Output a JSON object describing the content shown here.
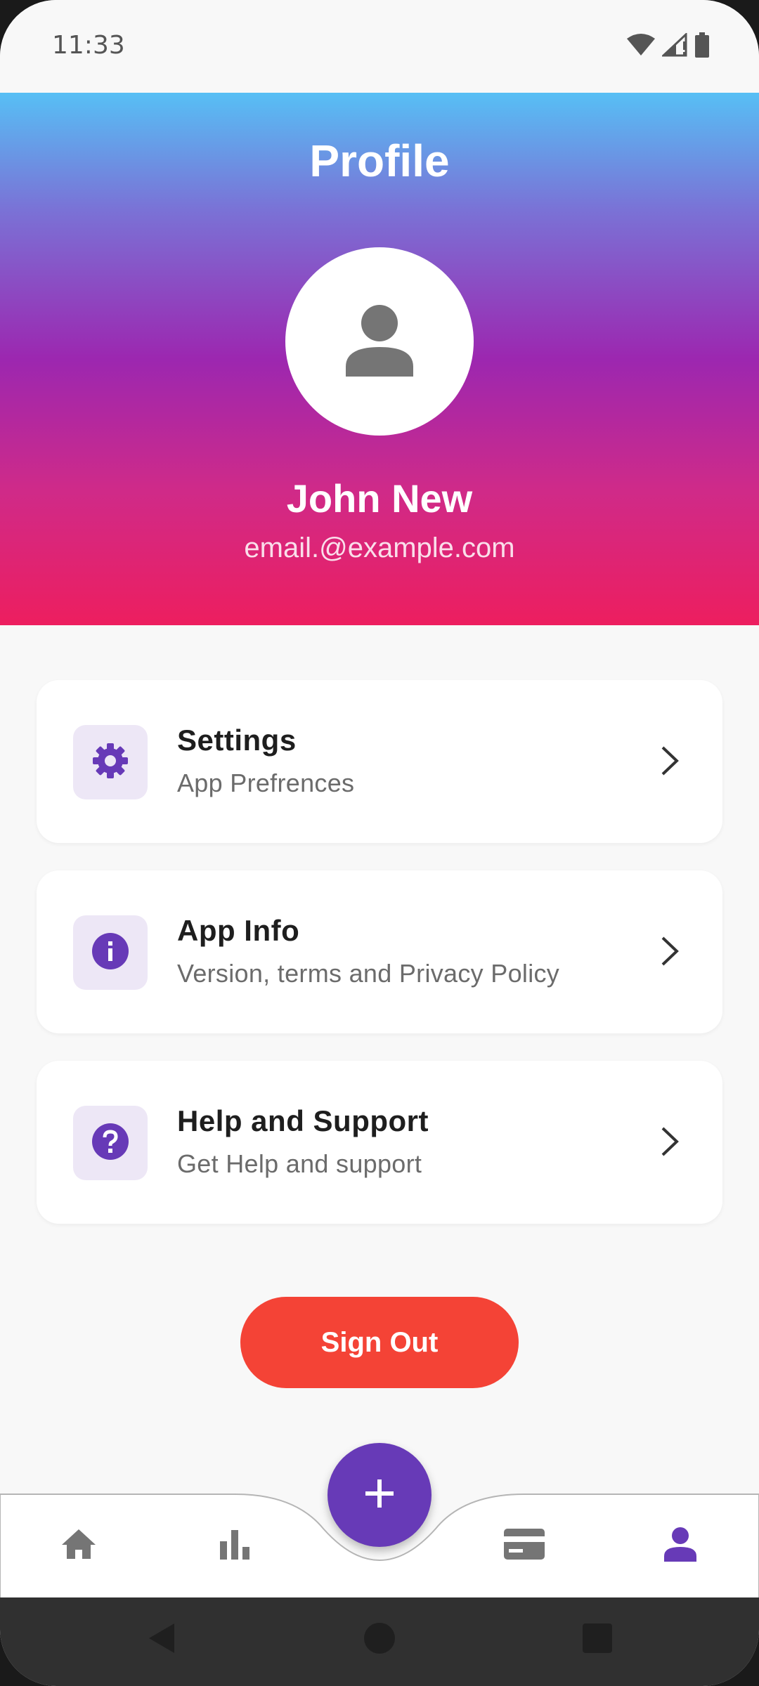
{
  "status_bar": {
    "time": "11:33",
    "icons": [
      "wifi-icon",
      "signal-icon",
      "battery-icon"
    ]
  },
  "header": {
    "title": "Profile",
    "avatar_icon": "person-icon",
    "user_name": "John New",
    "user_email": "email.@example.com"
  },
  "menu": {
    "items": [
      {
        "title": "Settings",
        "subtitle": "App Prefrences",
        "icon": "gear-icon"
      },
      {
        "title": "App Info",
        "subtitle": "Version, terms and Privacy Policy",
        "icon": "info-icon"
      },
      {
        "title": "Help and Support",
        "subtitle": "Get Help and support",
        "icon": "help-icon"
      }
    ]
  },
  "sign_out_label": "Sign Out",
  "bottom_nav": {
    "items": [
      "home-icon",
      "bar-chart-icon",
      "card-icon",
      "person-icon"
    ],
    "active": "person-icon",
    "fab_icon": "plus-icon"
  },
  "colors": {
    "accent": "#673ab7",
    "accent_light": "#ede7f6",
    "sign_out": "#f44336",
    "gradient_top": "#57bff5",
    "gradient_mid": "#9c27b0",
    "gradient_bottom": "#ed1e5f"
  }
}
